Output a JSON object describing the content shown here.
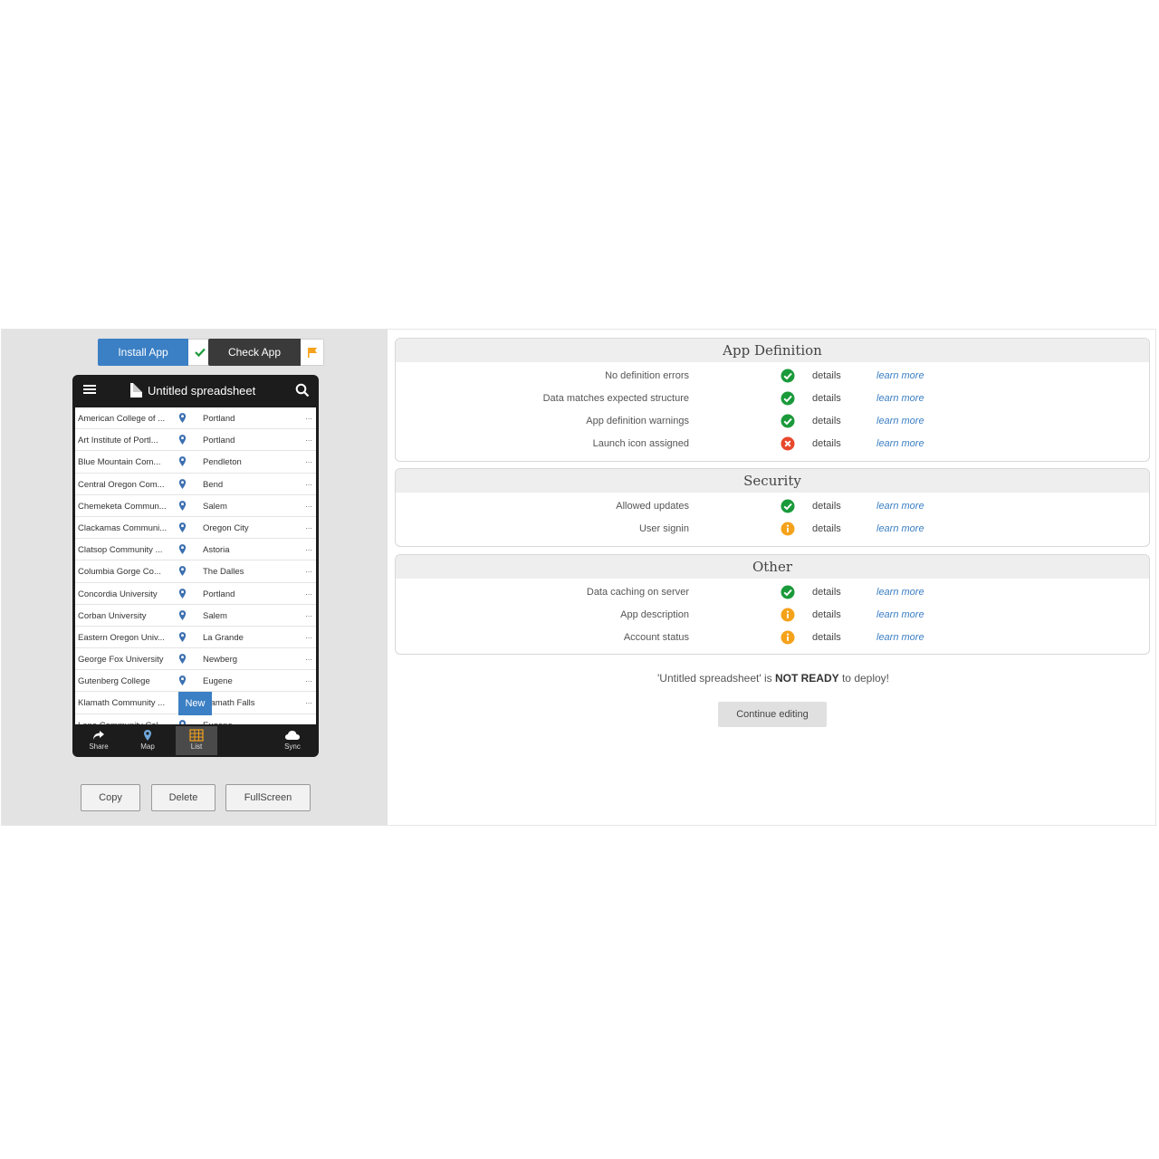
{
  "toolbar": {
    "install_label": "Install App",
    "check_label": "Check App"
  },
  "phone": {
    "title": "Untitled spreadsheet",
    "rows": [
      {
        "name": "American College of ...",
        "city": "Portland"
      },
      {
        "name": "Art Institute of Portl...",
        "city": "Portland"
      },
      {
        "name": "Blue Mountain Com...",
        "city": "Pendleton"
      },
      {
        "name": "Central Oregon Com...",
        "city": "Bend"
      },
      {
        "name": "Chemeketa Commun...",
        "city": "Salem"
      },
      {
        "name": "Clackamas Communi...",
        "city": "Oregon City"
      },
      {
        "name": "Clatsop Community ...",
        "city": "Astoria"
      },
      {
        "name": "Columbia Gorge Co...",
        "city": "The Dalles"
      },
      {
        "name": "Concordia University",
        "city": "Portland"
      },
      {
        "name": "Corban University",
        "city": "Salem"
      },
      {
        "name": "Eastern Oregon Univ...",
        "city": "La Grande"
      },
      {
        "name": "George Fox University",
        "city": "Newberg"
      },
      {
        "name": "Gutenberg College",
        "city": "Eugene"
      },
      {
        "name": "Klamath Community ...",
        "city": "Klamath Falls"
      },
      {
        "name": "Lane Community Col...",
        "city": "Eugene"
      }
    ],
    "row_more": "...",
    "new_label": "New",
    "footer": {
      "share": "Share",
      "map": "Map",
      "list": "List",
      "sync": "Sync"
    }
  },
  "actions": {
    "copy": "Copy",
    "delete": "Delete",
    "fullscreen": "FullScreen"
  },
  "sections": {
    "app_definition": {
      "title": "App Definition",
      "items": [
        {
          "label": "No definition errors",
          "status": "ok"
        },
        {
          "label": "Data matches expected structure",
          "status": "ok"
        },
        {
          "label": "App definition warnings",
          "status": "ok"
        },
        {
          "label": "Launch icon assigned",
          "status": "error"
        }
      ]
    },
    "security": {
      "title": "Security",
      "items": [
        {
          "label": "Allowed updates",
          "status": "ok"
        },
        {
          "label": "User signin",
          "status": "info"
        }
      ]
    },
    "other": {
      "title": "Other",
      "items": [
        {
          "label": "Data caching on server",
          "status": "ok"
        },
        {
          "label": "App description",
          "status": "info"
        },
        {
          "label": "Account status",
          "status": "info"
        }
      ]
    }
  },
  "details_label": "details",
  "learn_more_label": "learn more",
  "status_message": {
    "prefix": "'Untitled spreadsheet' is ",
    "bold": "NOT READY",
    "suffix": " to deploy!"
  },
  "continue_label": "Continue editing",
  "colors": {
    "ok": "#1a9a3a",
    "error": "#e8472b",
    "info": "#f5a21b",
    "accent": "#3b7fc4"
  }
}
